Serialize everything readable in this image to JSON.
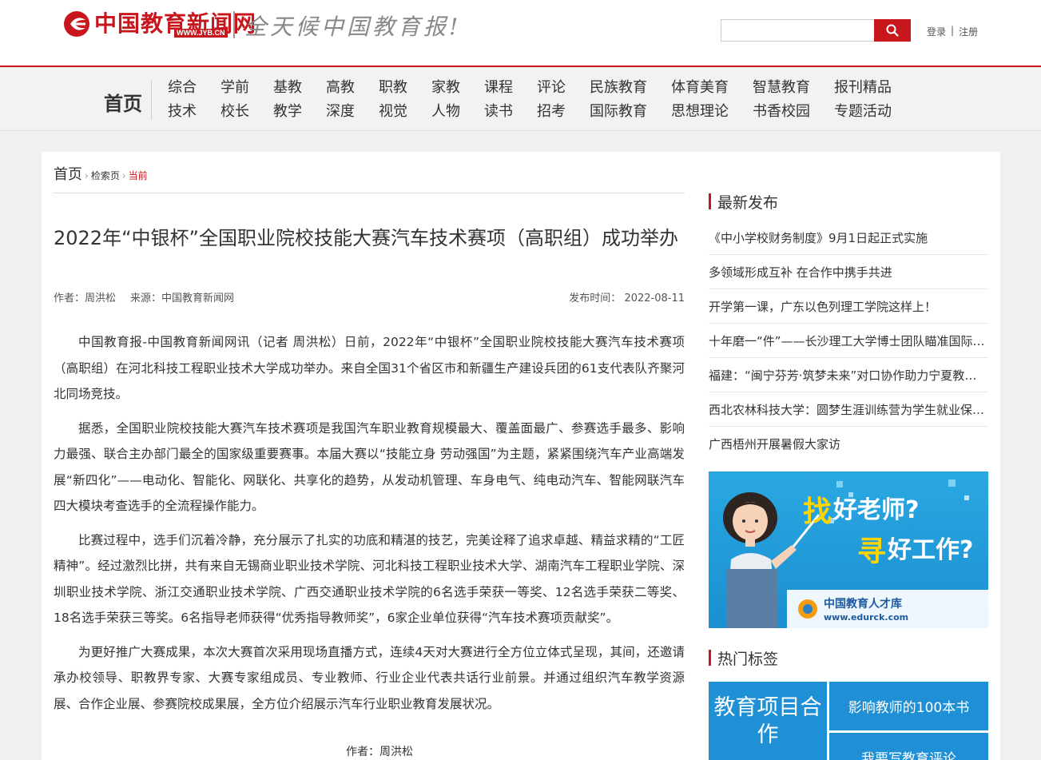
{
  "header": {
    "logo_name": "中国教育新闻网",
    "logo_url": "WWW.JYB.CN",
    "slogan": "全天候中国教育报!",
    "search_placeholder": "",
    "login": "登录",
    "separator": "|",
    "register": "注册"
  },
  "nav": {
    "home": "首页",
    "row1": [
      "综合",
      "学前",
      "基教",
      "高教",
      "职教",
      "家教",
      "课程",
      "评论",
      "民族教育",
      "体育美育",
      "智慧教育",
      "报刊精品"
    ],
    "row2": [
      "技术",
      "校长",
      "教学",
      "深度",
      "视觉",
      "人物",
      "读书",
      "招考",
      "国际教育",
      "思想理论",
      "书香校园",
      "专题活动"
    ]
  },
  "breadcrumb": {
    "home": "首页",
    "search": "检索页",
    "current": "当前",
    "arrow": "›"
  },
  "article": {
    "title": "2022年“中银杯”全国职业院校技能大赛汽车技术赛项（高职组）成功举办",
    "author_label": "作者：",
    "author": "周洪松",
    "source_label": "来源：",
    "source": "中国教育新闻网",
    "date_label": "发布时间：",
    "date": "2022-08-11",
    "paragraphs": [
      "中国教育报-中国教育新闻网讯（记者 周洪松）日前，2022年“中银杯”全国职业院校技能大赛汽车技术赛项（高职组）在河北科技工程职业技术大学成功举办。来自全国31个省区市和新疆生产建设兵团的61支代表队齐聚河北同场竞技。",
      "据悉，全国职业院校技能大赛汽车技术赛项是我国汽车职业教育规模最大、覆盖面最广、参赛选手最多、影响力最强、联合主办部门最全的国家级重要赛事。本届大赛以“技能立身 劳动强国”为主题，紧紧围绕汽车产业高端发展“新四化”——电动化、智能化、网联化、共享化的趋势，从发动机管理、车身电气、纯电动汽车、智能网联汽车四大模块考查选手的全流程操作能力。",
      "比赛过程中，选手们沉着冷静，充分展示了扎实的功底和精湛的技艺，完美诠释了追求卓越、精益求精的“工匠精神”。经过激烈比拼，共有来自无锡商业职业技术学院、河北科技工程职业技术大学、湖南汽车工程职业学院、深圳职业技术学院、浙江交通职业技术学院、广西交通职业技术学院的6名选手荣获一等奖、12名选手荣获二等奖、18名选手荣获三等奖。6名指导老师获得“优秀指导教师奖”，6家企业单位获得“汽车技术赛项贡献奖”。",
      "为更好推广大赛成果，本次大赛首次采用现场直播方式，连续4天对大赛进行全方位立体式呈现，其间，还邀请承办校领导、职教界专家、大赛专家组成员、专业教师、行业企业代表共话行业前景。并通过组织汽车教学资源展、合作企业展、参赛院校成果展，全方位介绍展示汽车行业职业教育发展状况。"
    ],
    "end_author": "作者：周洪松"
  },
  "sidebar": {
    "latest_title": "最新发布",
    "latest": [
      "《中小学校财务制度》9月1日起正式实施",
      "多领域形成互补 在合作中携手共进",
      "开学第一课，广东以色列理工学院这样上！",
      "十年磨一“件”——长沙理工大学博士团队瞄准国际前沿攻关",
      "福建：“闽宁芬芳·筑梦未来”对口协作助力宁夏教育发展",
      "西北农林科技大学：圆梦生涯训练营为学生就业保驾护航",
      "广西梧州开展暑假大家访"
    ],
    "ad": {
      "line1_big": "找",
      "line1_rest": "好老师?",
      "line2_big": "寻",
      "line2_rest": "好工作?",
      "brand": "中国教育人才库",
      "url": "www.edurck.com"
    },
    "hot_title": "热门标签",
    "tags": [
      "教育项目合作",
      "影响教师的100本书",
      "我要写教育评论"
    ],
    "colors": {
      "tag_bg": "#1f8fd6",
      "ad_bg": "#29a6e0"
    }
  },
  "colors": {
    "brand": "#c8161d"
  }
}
